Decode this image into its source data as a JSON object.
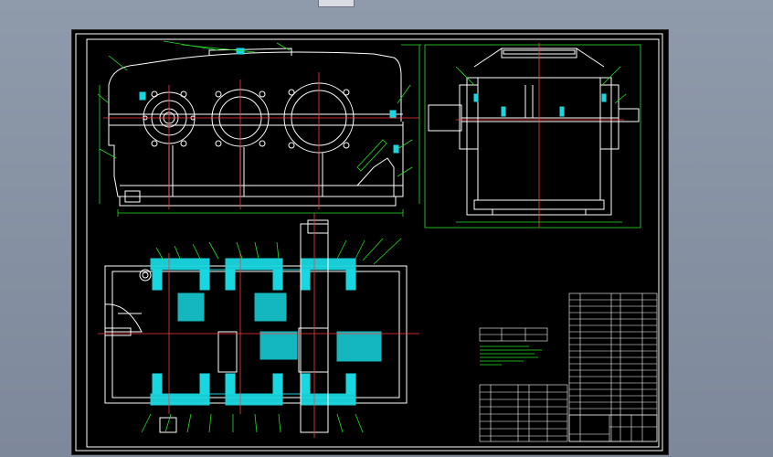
{
  "app": {
    "colors": {
      "background": "#8a95a6",
      "canvas": "#000000",
      "outline": "#ffffff",
      "centerline": "#ff3b3b",
      "dimension": "#23e023",
      "section_hatch": "#19d7e0"
    }
  },
  "drawing": {
    "views": [
      "front-view",
      "side-view",
      "plan-section-view",
      "notes-block",
      "parts-list",
      "title-block"
    ]
  }
}
